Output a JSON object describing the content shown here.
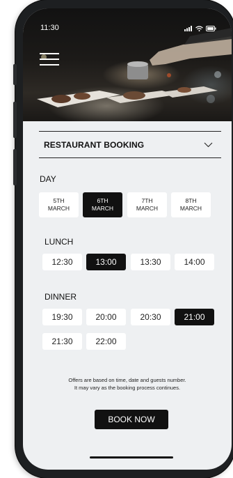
{
  "status_bar": {
    "time": "11:30"
  },
  "booking": {
    "title": "RESTAURANT BOOKING"
  },
  "day": {
    "label": "DAY",
    "dates": [
      {
        "line1": "5TH",
        "line2": "MARCH"
      },
      {
        "line1": "6TH",
        "line2": "MARCH"
      },
      {
        "line1": "7TH",
        "line2": "MARCH"
      },
      {
        "line1": "8TH",
        "line2": "MARCH"
      }
    ],
    "selected_index": 1
  },
  "lunch": {
    "label": "LUNCH",
    "times": [
      "12:30",
      "13:00",
      "13:30",
      "14:00"
    ],
    "selected": "13:00"
  },
  "dinner": {
    "label": "DINNER",
    "times": [
      "19:30",
      "20:00",
      "20:30",
      "21:00",
      "21:30",
      "22:00"
    ],
    "selected": "21:00"
  },
  "note": {
    "line1": "Offers are based on time, date and guests number.",
    "line2": "It may vary as the booking process continues."
  },
  "book_button": "BOOK NOW",
  "colors": {
    "accent": "#111111",
    "background": "#eef0f2",
    "chip": "#ffffff"
  }
}
